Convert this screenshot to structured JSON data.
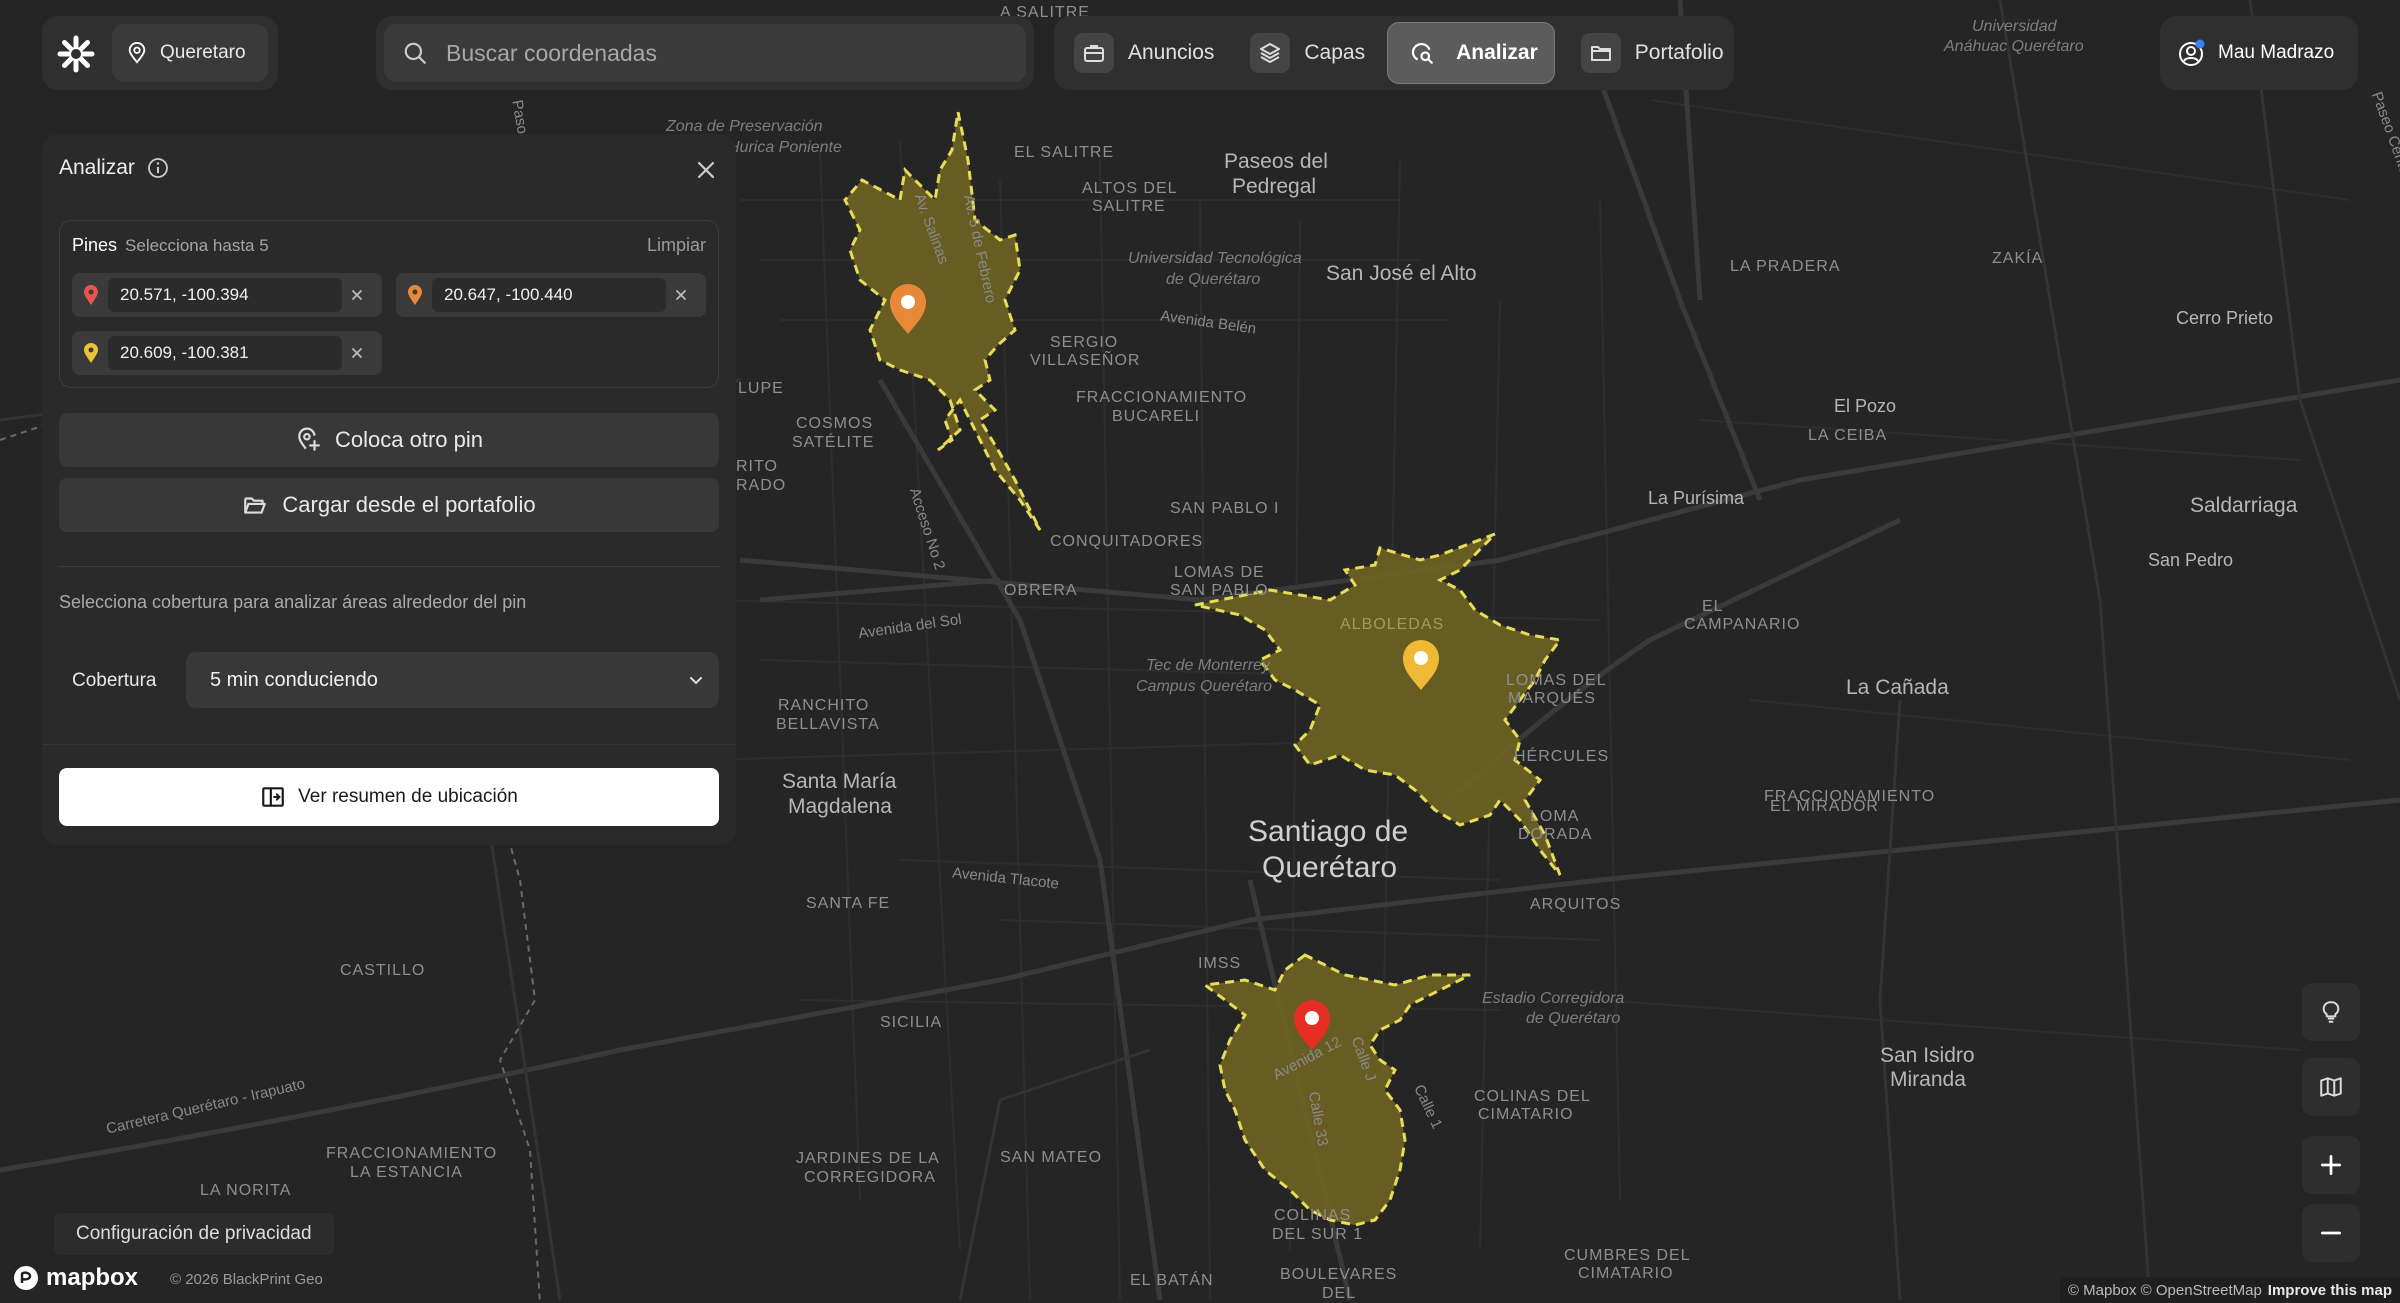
{
  "header": {
    "location_label": "Queretaro",
    "search_placeholder": "Buscar coordenadas",
    "nav": [
      {
        "label": "Anuncios",
        "icon": "briefcase-icon"
      },
      {
        "label": "Capas",
        "icon": "layers-icon"
      },
      {
        "label": "Analizar",
        "icon": "analyze-icon",
        "active": true
      },
      {
        "label": "Portafolio",
        "icon": "folder-icon"
      }
    ],
    "user_name": "Mau Madrazo"
  },
  "panel": {
    "title": "Analizar",
    "pins_title": "Pines",
    "pins_subtitle": "Selecciona hasta 5",
    "clear_label": "Limpiar",
    "pins": [
      {
        "coords": "20.571, -100.394",
        "color": "#e8554e"
      },
      {
        "coords": "20.647, -100.440",
        "color": "#e8893a"
      },
      {
        "coords": "20.609, -100.381",
        "color": "#e8c43a"
      }
    ],
    "place_pin_label": "Coloca otro pin",
    "load_portfolio_label": "Cargar desde el portafolio",
    "hint": "Selecciona cobertura para analizar áreas alrededor del pin",
    "coverage_label": "Cobertura",
    "coverage_value": "5 min conduciendo",
    "summary_button": "Ver resumen de ubicación"
  },
  "footer": {
    "privacy": "Configuración de privacidad",
    "mapbox": "mapbox",
    "copyright": "© 2026 BlackPrint Geo",
    "attribution": "© Mapbox © OpenStreetMap",
    "improve": "Improve this map"
  },
  "colors": {
    "isochrone_fill": "#6f6423",
    "isochrone_stroke": "#e6dc5a",
    "pin_red": "#e52d24",
    "pin_orange": "#e8893a",
    "pin_yellow": "#f0b935",
    "accent_dot": "#3b82f6"
  },
  "map_labels": [
    {
      "text": "Santiago de",
      "cls": "big"
    },
    {
      "text": "Querétaro",
      "cls": "big"
    },
    {
      "text": "Paseos del",
      "cls": "mid"
    },
    {
      "text": "Pedregal",
      "cls": "mid"
    },
    {
      "text": "San José el Alto",
      "cls": "mid"
    },
    {
      "text": "Santa María",
      "cls": "mid"
    },
    {
      "text": "Magdalena",
      "cls": "mid"
    },
    {
      "text": "La Cañada",
      "cls": "mid"
    },
    {
      "text": "Saldarriaga",
      "cls": "mid"
    },
    {
      "text": "San Isidro",
      "cls": "mid"
    },
    {
      "text": "Miranda",
      "cls": "mid"
    },
    {
      "text": "El Pozo",
      "cls": "it2"
    },
    {
      "text": "La Purísima",
      "cls": "it2"
    },
    {
      "text": "Cerro Prieto",
      "cls": "it2"
    },
    {
      "text": "San Pedro",
      "cls": "it2"
    },
    {
      "text": "EL SALITRE",
      "cls": ""
    },
    {
      "text": "ALTOS DEL",
      "cls": ""
    },
    {
      "text": "SALITRE",
      "cls": ""
    },
    {
      "text": "SERGIO",
      "cls": ""
    },
    {
      "text": "VILLASEÑOR",
      "cls": ""
    },
    {
      "text": "FRACCIONAMIENTO",
      "cls": ""
    },
    {
      "text": "BUCARELI",
      "cls": ""
    },
    {
      "text": "COSMOS",
      "cls": ""
    },
    {
      "text": "SATÉLITE",
      "cls": ""
    },
    {
      "text": "SAN PABLO I",
      "cls": ""
    },
    {
      "text": "CONQUITADORES",
      "cls": ""
    },
    {
      "text": "OBRERA",
      "cls": ""
    },
    {
      "text": "LOMAS DE",
      "cls": ""
    },
    {
      "text": "SAN PABLO",
      "cls": ""
    },
    {
      "text": "RANCHITO",
      "cls": ""
    },
    {
      "text": "BELLAVISTA",
      "cls": ""
    },
    {
      "text": "SANTA FE",
      "cls": ""
    },
    {
      "text": "CASTILLO",
      "cls": ""
    },
    {
      "text": "SICILIA",
      "cls": ""
    },
    {
      "text": "IMSS",
      "cls": ""
    },
    {
      "text": "SAN MATEO",
      "cls": ""
    },
    {
      "text": "JARDINES DE LA",
      "cls": ""
    },
    {
      "text": "CORREGIDORA",
      "cls": ""
    },
    {
      "text": "FRACCIONAMIENTO",
      "cls": ""
    },
    {
      "text": "LA ESTANCIA",
      "cls": ""
    },
    {
      "text": "LA NORITA",
      "cls": ""
    },
    {
      "text": "EL BATÁN",
      "cls": ""
    },
    {
      "text": "BOULEVARES",
      "cls": ""
    },
    {
      "text": "DEL",
      "cls": ""
    },
    {
      "text": "COLINAS",
      "cls": ""
    },
    {
      "text": "DEL SUR 1",
      "cls": ""
    },
    {
      "text": "COLINAS DEL",
      "cls": ""
    },
    {
      "text": "CIMATARIO",
      "cls": ""
    },
    {
      "text": "CUMBRES DEL",
      "cls": ""
    },
    {
      "text": "CIMATARIO",
      "cls": ""
    },
    {
      "text": "ARQUITOS",
      "cls": ""
    },
    {
      "text": "HÉRCULES",
      "cls": ""
    },
    {
      "text": "LOMA",
      "cls": ""
    },
    {
      "text": "DORADA",
      "cls": ""
    },
    {
      "text": "LOMAS DEL",
      "cls": ""
    },
    {
      "text": "MARQUÉS",
      "cls": ""
    },
    {
      "text": "ALBOLEDAS",
      "cls": ""
    },
    {
      "text": "EL",
      "cls": ""
    },
    {
      "text": "CAMPANARIO",
      "cls": ""
    },
    {
      "text": "FRACCIONAMIENTO",
      "cls": ""
    },
    {
      "text": "EL MIRADOR",
      "cls": ""
    },
    {
      "text": "LA PRADERA",
      "cls": ""
    },
    {
      "text": "ZAKÍA",
      "cls": ""
    },
    {
      "text": "LA CEIBA",
      "cls": ""
    },
    {
      "text": "Zona de Preservación",
      "cls": "it"
    },
    {
      "text": "Hurica Poniente",
      "cls": "it"
    },
    {
      "text": "Universidad Tecnológica",
      "cls": "it"
    },
    {
      "text": "de Querétaro",
      "cls": "it"
    },
    {
      "text": "Tec de Monterrey",
      "cls": "it"
    },
    {
      "text": "Campus Querétaro",
      "cls": "it"
    },
    {
      "text": "Estadio Corregidora",
      "cls": "it"
    },
    {
      "text": "de Querétaro",
      "cls": "it"
    },
    {
      "text": "Universidad",
      "cls": "it"
    },
    {
      "text": "Anáhuac Querétaro",
      "cls": "it"
    },
    {
      "text": "Avenida Belén",
      "cls": "road"
    },
    {
      "text": "Avenida del Sol",
      "cls": "road"
    },
    {
      "text": "Avenida Tlacote",
      "cls": "road"
    },
    {
      "text": "Carretera Querétaro - Irapuato",
      "cls": "road"
    },
    {
      "text": "Acceso No 2",
      "cls": "road"
    },
    {
      "text": "Avenida 12",
      "cls": "road"
    },
    {
      "text": "Calle 33",
      "cls": "road"
    },
    {
      "text": "Calle 1",
      "cls": "road"
    },
    {
      "text": "Calle J",
      "cls": "road"
    },
    {
      "text": "Av. Salinas",
      "cls": "road"
    },
    {
      "text": "Av. 5 de Febrero",
      "cls": "road"
    },
    {
      "text": "LUPE",
      "cls": ""
    },
    {
      "text": "RITO",
      "cls": ""
    },
    {
      "text": "RADO",
      "cls": ""
    },
    {
      "text": "Paso",
      "cls": "road"
    },
    {
      "text": "Paseo Centenario",
      "cls": "road"
    },
    {
      "text": "A SALITRE",
      "cls": ""
    }
  ]
}
